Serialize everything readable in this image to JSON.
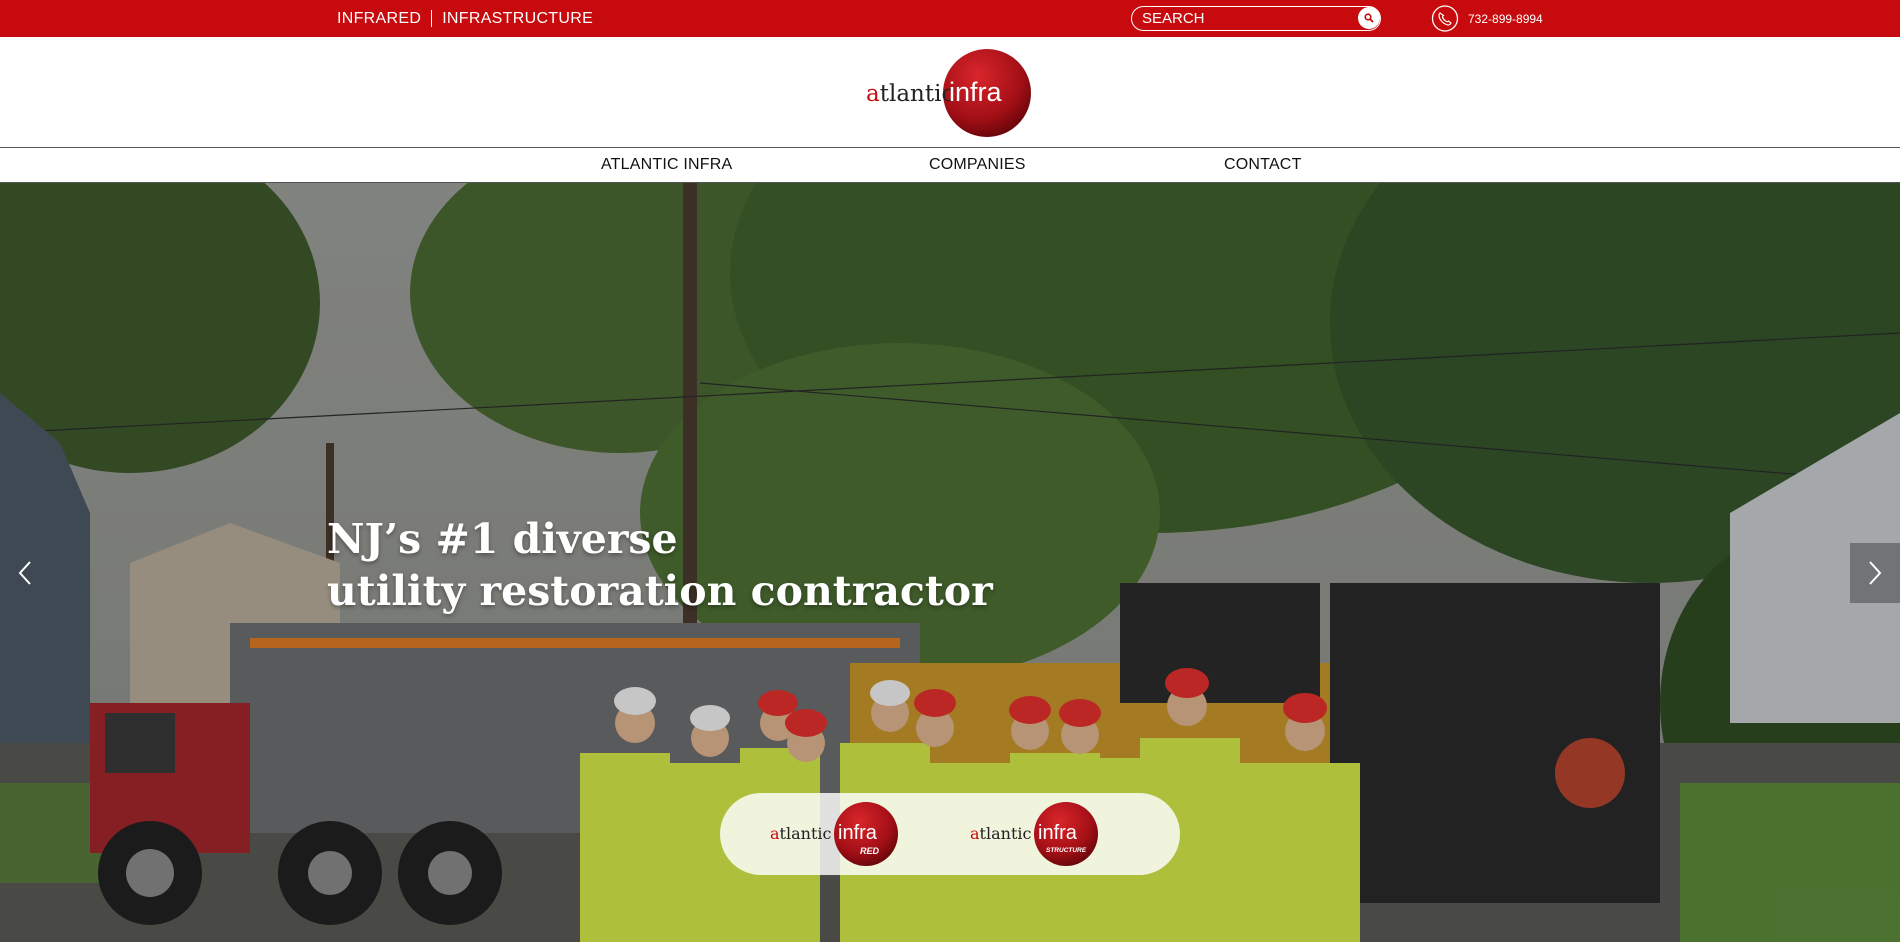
{
  "topbar": {
    "link_infrared": "INFRARED",
    "link_infrastructure": "INFRASTRUCTURE",
    "search_placeholder": "SEARCH",
    "phone": "732-899-8994",
    "icons": [
      "search-icon",
      "phone-icon"
    ]
  },
  "logo": {
    "word_prefix": "atlantic",
    "word_badge": "infra"
  },
  "nav": {
    "items": [
      {
        "label": "ATLANTIC INFRA"
      },
      {
        "label": "COMPANIES"
      },
      {
        "label": "CONTACT"
      }
    ]
  },
  "hero": {
    "headline_line1": "NJ’s #1 diverse",
    "headline_line2": "utility restoration contractor",
    "prev_icon": "chevron-left-icon",
    "next_icon": "chevron-right-icon"
  },
  "company_logos": [
    {
      "prefix": "atlantic",
      "badge": "infra",
      "sub": "RED"
    },
    {
      "prefix": "atlantic",
      "badge": "infra",
      "sub": "STRUCTURE"
    }
  ],
  "colors": {
    "brand_red": "#c70a0d",
    "badge_red": "#a3101a"
  }
}
